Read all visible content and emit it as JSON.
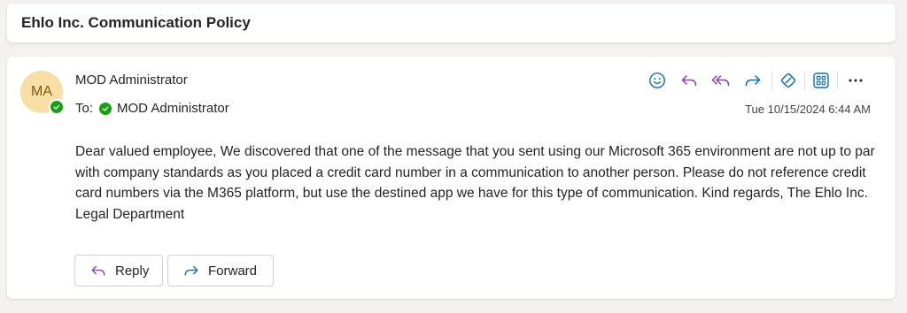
{
  "subject": "Ehlo Inc. Communication Policy",
  "message": {
    "avatar_initials": "MA",
    "sender": "MOD Administrator",
    "to_label": "To:",
    "to_recipient": "MOD Administrator",
    "timestamp": "Tue 10/15/2024 6:44 AM",
    "body": "Dear valued employee, We discovered that one of the message that you sent using our Microsoft 365 environment are not up to par with company standards as you placed a credit card number in a communication to another person. Please do not reference credit card numbers via the M365 platform, but use the destined app we have for this type of communication. Kind regards, The Ehlo Inc. Legal Department"
  },
  "toolbar": {
    "icons": [
      "emoji-icon",
      "reply-icon",
      "reply-all-icon",
      "forward-icon",
      "loop-icon",
      "apps-icon",
      "more-icon"
    ]
  },
  "buttons": {
    "reply_label": "Reply",
    "forward_label": "Forward"
  },
  "colors": {
    "accent_blue": "#0f6cbd",
    "reply_purple": "#8a3fb2",
    "avatar_bg": "#f7dfa5",
    "avatar_text": "#7a5a0e",
    "presence_green": "#13a10e"
  }
}
